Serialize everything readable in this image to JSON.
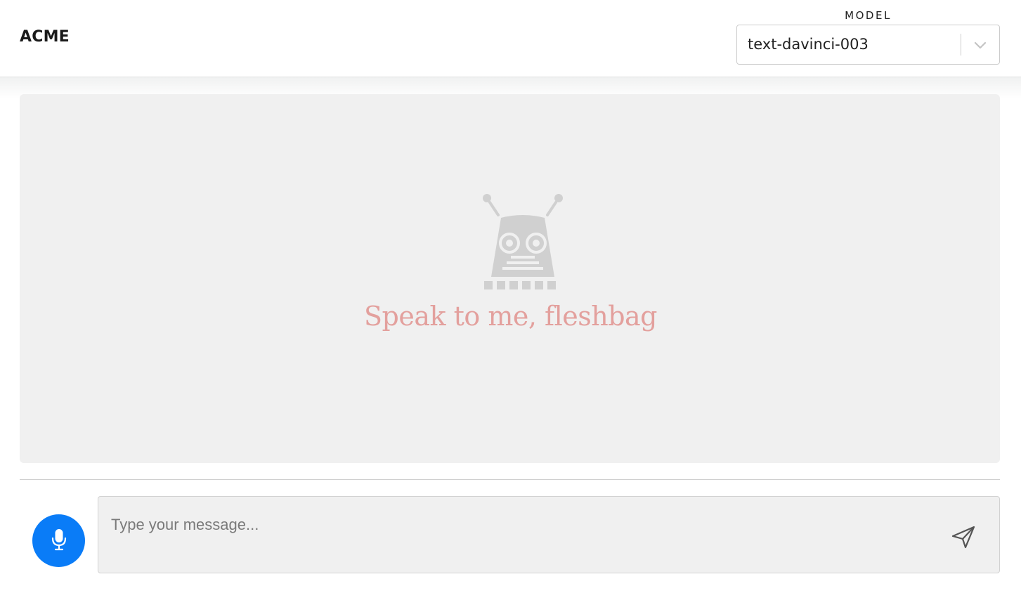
{
  "header": {
    "brand": "ACME",
    "model_label": "MODEL",
    "model_value": "text-davinci-003"
  },
  "chat": {
    "empty_state_text": "Speak to me, fleshbag",
    "empty_state_icon": "robot-icon"
  },
  "composer": {
    "placeholder": "Type your message...",
    "mic_icon": "microphone-icon",
    "send_icon": "send-icon"
  },
  "colors": {
    "accent": "#0a7cf7",
    "chat_background": "#f0f0f0",
    "tagline": "#e3a09d",
    "robot": "#d0d0d0"
  }
}
